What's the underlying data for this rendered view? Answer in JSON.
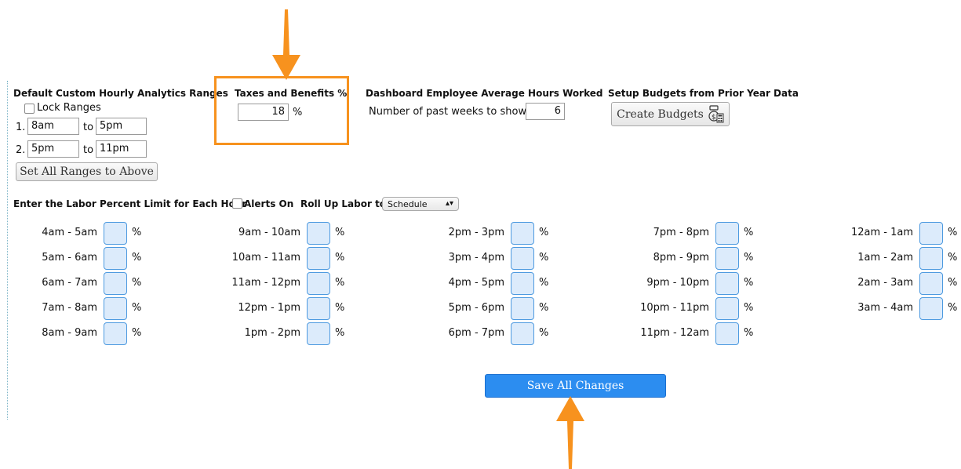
{
  "analytics": {
    "title": "Default Custom Hourly Analytics Ranges",
    "lock_label": "Lock Ranges",
    "ranges": [
      {
        "num": "1.",
        "from": "8am",
        "to_label": "to",
        "to": "5pm"
      },
      {
        "num": "2.",
        "from": "5pm",
        "to_label": "to",
        "to": "11pm"
      }
    ],
    "set_all_label": "Set All Ranges to Above"
  },
  "taxes": {
    "title": "Taxes and Benefits %",
    "value": "18",
    "unit": "%"
  },
  "dashboard": {
    "title": "Dashboard Employee Average Hours Worked",
    "weeks_label": "Number of past weeks to show",
    "weeks_value": "6"
  },
  "budgets": {
    "title": "Setup Budgets from Prior Year Data",
    "button_label": "Create Budgets",
    "icon": "money-calculator-icon"
  },
  "labor": {
    "title": "Enter the Labor Percent Limit for Each Hour",
    "alerts_label": "Alerts On",
    "rollup_label": "Roll Up Labor to",
    "rollup_value": "Schedule",
    "unit": "%",
    "hours": [
      [
        "4am - 5am",
        "5am - 6am",
        "6am - 7am",
        "7am - 8am",
        "8am - 9am"
      ],
      [
        "9am - 10am",
        "10am - 11am",
        "11am - 12pm",
        "12pm - 1pm",
        "1pm - 2pm"
      ],
      [
        "2pm - 3pm",
        "3pm - 4pm",
        "4pm - 5pm",
        "5pm - 6pm",
        "6pm - 7pm"
      ],
      [
        "7pm - 8pm",
        "8pm - 9pm",
        "9pm - 10pm",
        "10pm - 11pm",
        "11pm - 12am"
      ],
      [
        "12am - 1am",
        "1am - 2am",
        "2am - 3am",
        "3am - 4am"
      ]
    ]
  },
  "save_label": "Save All Changes",
  "colors": {
    "annotation": "#f7921e",
    "save_button": "#2c8df0",
    "hour_input_bg": "#dcebfb"
  }
}
